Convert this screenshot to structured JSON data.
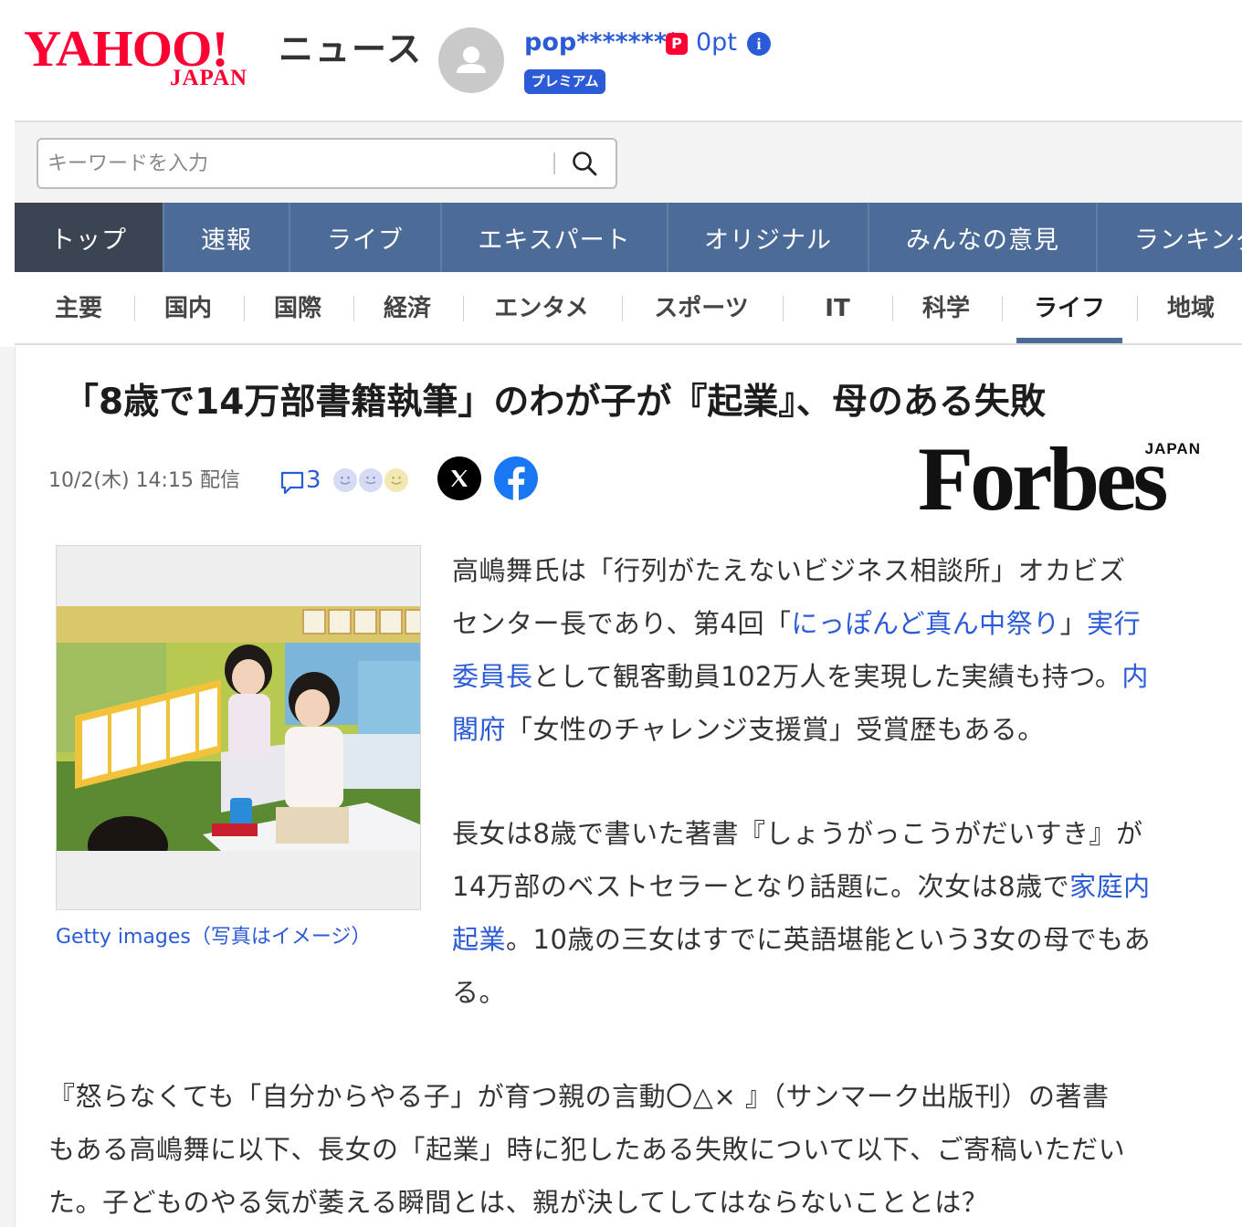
{
  "header": {
    "logo_yahoo": "YAHOO!",
    "logo_japan": "JAPAN",
    "logo_news": "ニュース",
    "username": "pop********",
    "premium_label": "プレミアム",
    "points": "0pt",
    "brand_color": "#ff0033",
    "accent_color": "#2b5bd7"
  },
  "search": {
    "placeholder": "キーワードを入力"
  },
  "main_nav": {
    "items": [
      {
        "label": "トップ"
      },
      {
        "label": "速報"
      },
      {
        "label": "ライブ"
      },
      {
        "label": "エキスパート"
      },
      {
        "label": "オリジナル"
      },
      {
        "label": "みんなの意見"
      },
      {
        "label": "ランキング"
      }
    ],
    "active_index": 0,
    "color": "#4c6b97"
  },
  "sub_nav": {
    "items": [
      {
        "label": "主要"
      },
      {
        "label": "国内"
      },
      {
        "label": "国際"
      },
      {
        "label": "経済"
      },
      {
        "label": "エンタメ"
      },
      {
        "label": "スポーツ"
      },
      {
        "label": "IT"
      },
      {
        "label": "科学"
      },
      {
        "label": "ライフ"
      },
      {
        "label": "地域"
      }
    ],
    "active_index": 8
  },
  "article": {
    "title": "「8歳で14万部書籍執筆」のわが子が『起業』、母のある失敗",
    "date": "10/2(木) 14:15 配信",
    "comment_count": "3",
    "publisher_word": "Forbes",
    "publisher_sub": "JAPAN",
    "image_caption": "Getty images（写真はイメージ）",
    "p1": {
      "l1": "高嶋舞氏は「行列がたえないビジネス相談所」オカビズ",
      "l2a": "センター長であり、第4回「",
      "l2link": "にっぽんど真ん中祭り",
      "l2b": "」",
      "l2link2": "実行",
      "l3link": "委員長",
      "l3b": "として観客動員102万人を実現した実績も持つ。",
      "l3link2": "内",
      "l4link": "閣府",
      "l4b": "「女性のチャレンジ支援賞」受賞歴もある。"
    },
    "p2": {
      "l1": "長女は8歳で書いた著書『しょうがっこうがだいすき』が",
      "l2a": "14万部のベストセラーとなり話題に。次女は8歳で",
      "l2link": "家庭内",
      "l3link": "起業",
      "l3b": "。10歳の三女はすでに英語堪能という3女の母でもあ",
      "l4": "る。"
    },
    "p3": {
      "l1": "『怒らなくても「自分からやる子」が育つ親の言動〇△× 』（サンマーク出版刊）の著書",
      "l2": "もある高嶋舞に以下、長女の「起業」時に犯したある失敗について以下、ご寄稿いただい",
      "l3": "た。子どものやる気が萎える瞬間とは、親が決してしてはならないこととは？"
    }
  }
}
